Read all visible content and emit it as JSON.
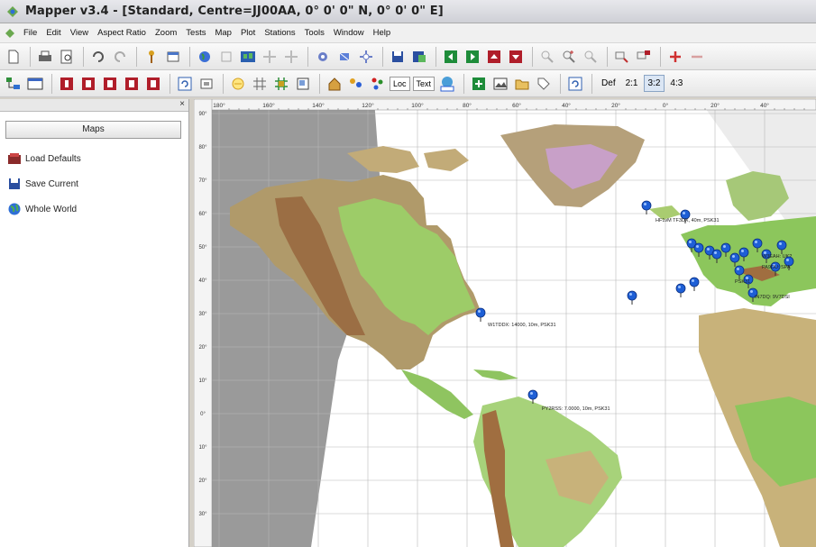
{
  "window": {
    "title": "Mapper v3.4 - [Standard, Centre=JJ00AA, 0° 0' 0\" N, 0° 0' 0\" E]"
  },
  "menu": {
    "items": [
      "File",
      "Edit",
      "View",
      "Aspect Ratio",
      "Zoom",
      "Tests",
      "Map",
      "Plot",
      "Stations",
      "Tools",
      "Window",
      "Help"
    ]
  },
  "toolbar2": {
    "loc_label": "Loc",
    "text_label": "Text",
    "ratio_def": "Def",
    "ratio_21": "2:1",
    "ratio_32": "3:2",
    "ratio_43": "4:3",
    "active_ratio": "3:2"
  },
  "sidebar": {
    "tab": "Maps",
    "items": [
      {
        "label": "Load Defaults",
        "icon": "load-defaults-icon"
      },
      {
        "label": "Save Current",
        "icon": "save-icon"
      },
      {
        "label": "Whole World",
        "icon": "globe-icon"
      }
    ]
  },
  "map": {
    "lon_labels": [
      "180°",
      "160°",
      "140°",
      "120°",
      "100°",
      "80°",
      "60°",
      "40°",
      "20°",
      "0°",
      "20°",
      "40°"
    ],
    "lat_labels": [
      "90°",
      "80°",
      "70°",
      "60°",
      "50°",
      "40°",
      "30°",
      "20°",
      "10°",
      "0°",
      "10°",
      "20°",
      "30°"
    ],
    "stations": [
      {
        "name": "W1TDDX",
        "label": "W1TDDX: 14000, 10m, PSK31"
      },
      {
        "name": "PY2RSS",
        "label": "PY2RSS: 7.0000, 10m, PSK31"
      },
      {
        "name": "TF",
        "label": "HF1vM TF3DX, 40m, PSK31"
      },
      {
        "name": "EU1",
        "label": "W3EAH: UK2"
      },
      {
        "name": "EU2",
        "label": "PA9DU: SPA"
      },
      {
        "name": "EU3",
        "label": "PSK31"
      },
      {
        "name": "EU4",
        "label": "IN7DQ: 9V7DSI"
      }
    ],
    "colors": {
      "ocean": "#ffffff",
      "night": "#9a9a9a",
      "lowland": "#9dd06a",
      "upland": "#c8b47c",
      "mountain": "#a8794c",
      "ice": "#c4a0c8",
      "marker": "#1e5fd6"
    }
  }
}
